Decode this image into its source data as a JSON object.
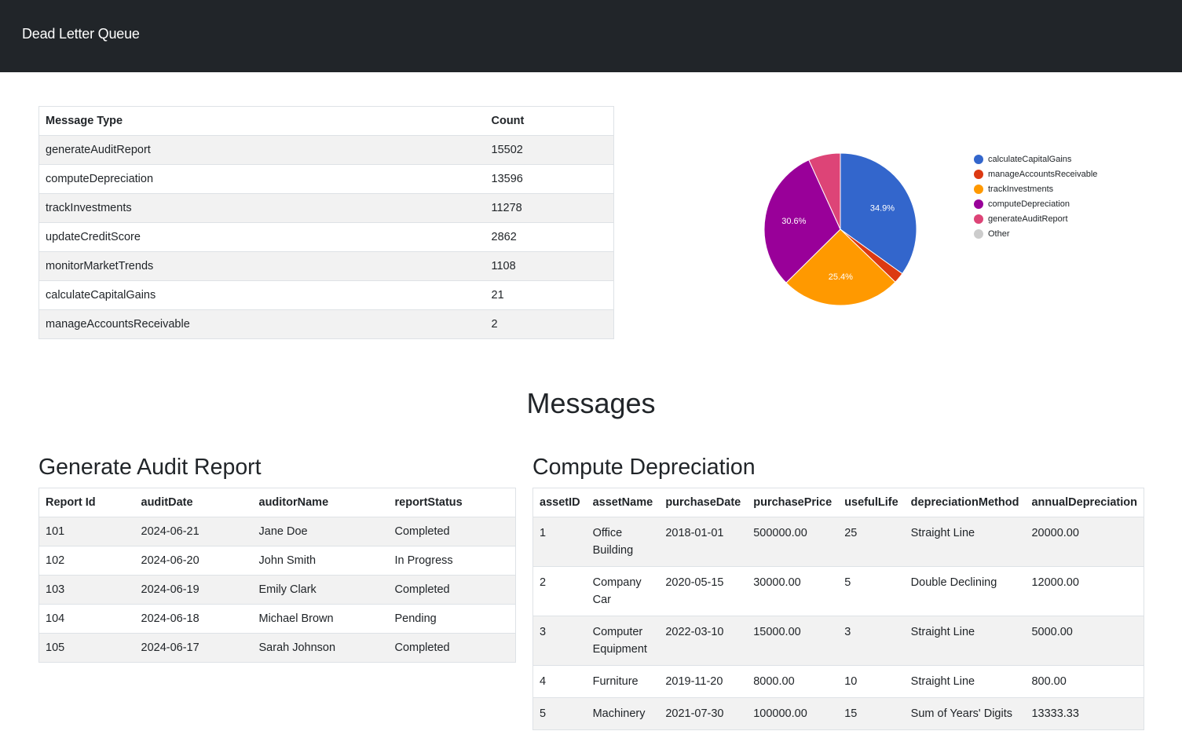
{
  "navbar": {
    "brand": "Dead Letter Queue"
  },
  "summary": {
    "headers": [
      "Message Type",
      "Count"
    ],
    "rows": [
      [
        "generateAuditReport",
        "15502"
      ],
      [
        "computeDepreciation",
        "13596"
      ],
      [
        "trackInvestments",
        "11278"
      ],
      [
        "updateCreditScore",
        "2862"
      ],
      [
        "monitorMarketTrends",
        "1108"
      ],
      [
        "calculateCapitalGains",
        "21"
      ],
      [
        "manageAccountsReceivable",
        "2"
      ]
    ]
  },
  "chart_data": {
    "type": "pie",
    "title": "",
    "slices": [
      {
        "label": "calculateCapitalGains",
        "value": 34.9,
        "color": "#3366cc",
        "pct_label": "34.9%"
      },
      {
        "label": "manageAccountsReceivable",
        "value": 2.3,
        "color": "#dc3912",
        "pct_label": ""
      },
      {
        "label": "trackInvestments",
        "value": 25.4,
        "color": "#ff9900",
        "pct_label": "25.4%"
      },
      {
        "label": "computeDepreciation",
        "value": 30.6,
        "color": "#990099",
        "pct_label": "30.6%"
      },
      {
        "label": "generateAuditReport",
        "value": 6.8,
        "color": "#dd4477",
        "pct_label": ""
      },
      {
        "label": "Other",
        "value": 0,
        "color": "#cccccc",
        "pct_label": ""
      }
    ],
    "legend_position": "right"
  },
  "messages": {
    "title": "Messages",
    "audit": {
      "title": "Generate Audit Report",
      "headers": [
        "Report Id",
        "auditDate",
        "auditorName",
        "reportStatus"
      ],
      "rows": [
        [
          "101",
          "2024-06-21",
          "Jane Doe",
          "Completed"
        ],
        [
          "102",
          "2024-06-20",
          "John Smith",
          "In Progress"
        ],
        [
          "103",
          "2024-06-19",
          "Emily Clark",
          "Completed"
        ],
        [
          "104",
          "2024-06-18",
          "Michael Brown",
          "Pending"
        ],
        [
          "105",
          "2024-06-17",
          "Sarah Johnson",
          "Completed"
        ]
      ]
    },
    "depreciation": {
      "title": "Compute Depreciation",
      "headers": [
        "assetID",
        "assetName",
        "purchaseDate",
        "purchasePrice",
        "usefulLife",
        "depreciationMethod",
        "annualDepreciation"
      ],
      "rows": [
        [
          "1",
          "Office Building",
          "2018-01-01",
          "500000.00",
          "25",
          "Straight Line",
          "20000.00"
        ],
        [
          "2",
          "Company Car",
          "2020-05-15",
          "30000.00",
          "5",
          "Double Declining",
          "12000.00"
        ],
        [
          "3",
          "Computer Equipment",
          "2022-03-10",
          "15000.00",
          "3",
          "Straight Line",
          "5000.00"
        ],
        [
          "4",
          "Furniture",
          "2019-11-20",
          "8000.00",
          "10",
          "Straight Line",
          "800.00"
        ],
        [
          "5",
          "Machinery",
          "2021-07-30",
          "100000.00",
          "15",
          "Sum of Years' Digits",
          "13333.33"
        ]
      ]
    }
  }
}
